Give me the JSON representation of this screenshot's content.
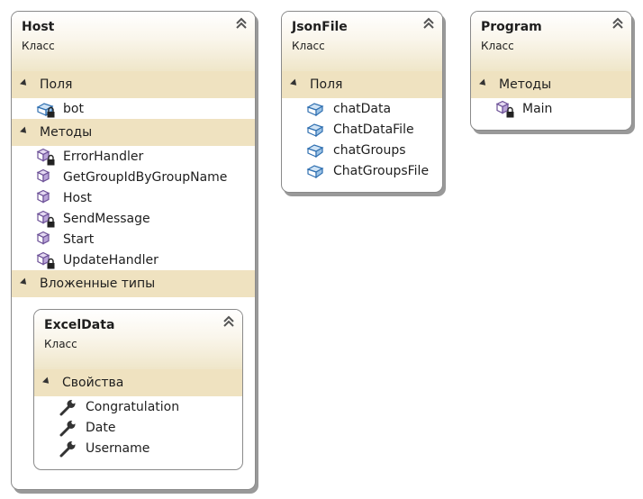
{
  "classes": {
    "host": {
      "name": "Host",
      "kind": "Класс",
      "fields_label": "Поля",
      "fields": [
        "bot"
      ],
      "methods_label": "Методы",
      "methods": [
        "ErrorHandler",
        "GetGroupIdByGroupName",
        "Host",
        "SendMessage",
        "Start",
        "UpdateHandler"
      ],
      "nested_label": "Вложенные типы",
      "nested": {
        "name": "ExcelData",
        "kind": "Класс",
        "props_label": "Свойства",
        "props": [
          "Congratulation",
          "Date",
          "Username"
        ]
      }
    },
    "jsonfile": {
      "name": "JsonFile",
      "kind": "Класс",
      "fields_label": "Поля",
      "fields": [
        "chatData",
        "ChatDataFile",
        "chatGroups",
        "ChatGroupsFile"
      ]
    },
    "program": {
      "name": "Program",
      "kind": "Класс",
      "methods_label": "Методы",
      "methods": [
        "Main"
      ]
    }
  },
  "icons": {
    "private_field": "field-lock-icon",
    "public_field": "field-icon",
    "private_method": "method-lock-icon",
    "public_method": "method-icon",
    "property": "wrench-icon",
    "collapse": "double-chevron-up-icon"
  },
  "colors": {
    "section_bg": "#efe2c0",
    "header_gradient_end": "#efe6c9",
    "field_icon": "#2f6fb0",
    "method_icon": "#7d5ca6"
  }
}
